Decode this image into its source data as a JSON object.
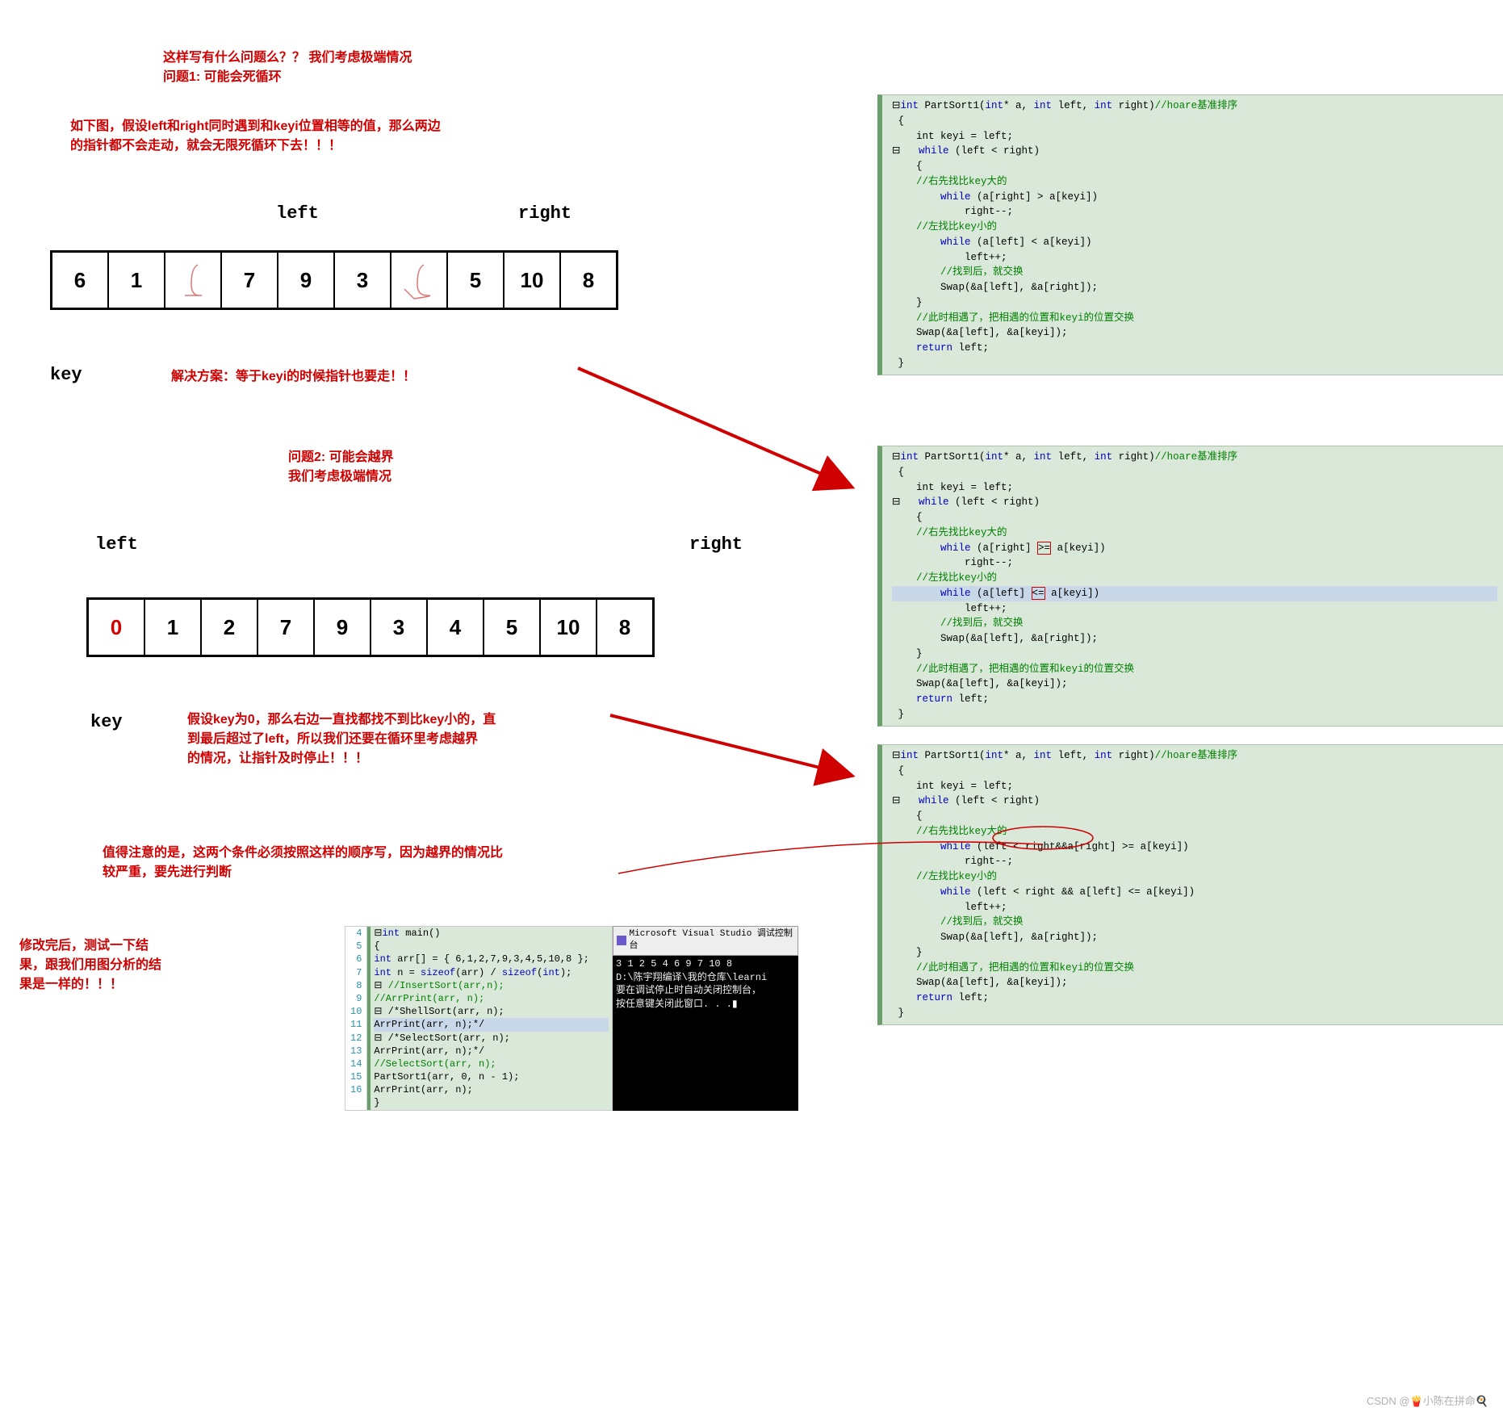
{
  "texts": {
    "q_intro": "这样写有什么问题么？？ 我们考虑极端情况",
    "q1": "问题1: 可能会死循环",
    "assume1a": "如下图，假设left和right同时遇到和keyi位置相等的值，那么两边",
    "assume1b": "的指针都不会走动，就会无限死循环下去！！！",
    "left_lbl": "left",
    "right_lbl": "right",
    "key_lbl": "key",
    "solution1": "解决方案：等于keyi的时候指针也要走！！",
    "q2": "问题2: 可能会越界",
    "q2b": "我们考虑极端情况",
    "assume2a": "假设key为0，那么右边一直找都找不到比key小的，直",
    "assume2b": "到最后超过了left，所以我们还要在循环里考虑越界",
    "assume2c": "的情况，让指针及时停止！！！",
    "note1": "值得注意的是，这两个条件必须按照这样的顺序写，因为越界的情况比",
    "note2": "较严重，要先进行判断",
    "result1": "修改完后，测试一下结",
    "result2": "果，跟我们用图分析的结",
    "result3": "果是一样的！！！",
    "hoare_cm": "//hoare基准排序",
    "cm_rbig": "//右先找比key大的",
    "cm_lsmall": "//左找比key小的",
    "cm_swap": "//找到后，就交换",
    "cm_meet": "//此时相遇了，把相遇的位置和keyi的位置交换"
  },
  "arrays": {
    "a1": [
      "6",
      "1",
      "",
      "7",
      "9",
      "3",
      "",
      "5",
      "10",
      "8"
    ],
    "a2": [
      "0",
      "1",
      "2",
      "7",
      "9",
      "3",
      "4",
      "5",
      "10",
      "8"
    ]
  },
  "code": {
    "decl": "int PartSort1(int* a, int left, int right)",
    "keyi": "int keyi = left;",
    "while_lr": "while (left < right)",
    "w1_r": "while (a[right] > a[keyi])",
    "w1_l": "while (a[left] < a[keyi])",
    "w2_r": "while (a[right] >= a[keyi])",
    "w2_l": "while (a[left] <= a[keyi])",
    "w3_r": "while (left < right&&a[right] >= a[keyi])",
    "w3_l": "while (left < right && a[left] <= a[keyi])",
    "rdec": "right--;",
    "linc": "left++;",
    "swap_lr": "Swap(&a[left], &a[right]);",
    "swap_lk": "Swap(&a[left], &a[keyi]);",
    "ret": "return left;"
  },
  "main_code": {
    "lines": [
      {
        "n": "4",
        "t": "⊟int main()"
      },
      {
        "n": "5",
        "t": " {"
      },
      {
        "n": "6",
        "t": "     int arr[] = { 6,1,2,7,9,3,4,5,10,8 };"
      },
      {
        "n": "7",
        "t": "     int n = sizeof(arr) / sizeof(int);"
      },
      {
        "n": "8",
        "t": "⊟    //InsertSort(arr,n);"
      },
      {
        "n": "9",
        "t": "     //ArrPrint(arr, n);"
      },
      {
        "n": "10",
        "t": "⊟    /*ShellSort(arr, n);"
      },
      {
        "n": "11",
        "t": "     ArrPrint(arr, n);*/",
        "hl": true
      },
      {
        "n": "12",
        "t": "⊟    /*SelectSort(arr, n);"
      },
      {
        "n": "13",
        "t": "     ArrPrint(arr, n);*/"
      },
      {
        "n": "14",
        "t": "     //SelectSort(arr, n);"
      },
      {
        "n": "15",
        "t": "     PartSort1(arr, 0, n - 1);"
      },
      {
        "n": "16",
        "t": "     ArrPrint(arr, n);"
      },
      {
        "n": "",
        "t": " }"
      }
    ]
  },
  "console": {
    "title": "Microsoft Visual Studio 调试控制台",
    "out1": "3 1 2 5 4 6 9 7 10 8",
    "out2": "D:\\陈宇翔编译\\我的仓库\\learni",
    "out3": "要在调试停止时自动关闭控制台，",
    "out4": "按任意键关闭此窗口. . ."
  },
  "watermark": "CSDN @🍟小陈在拼命🍳"
}
